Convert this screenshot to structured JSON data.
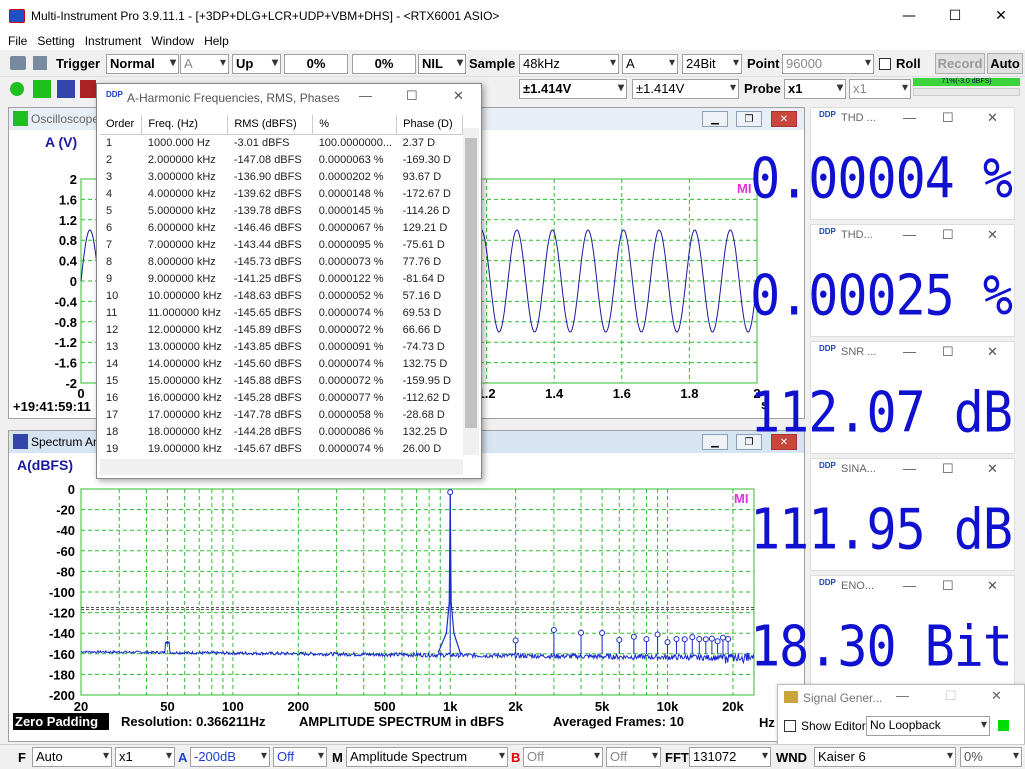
{
  "window": {
    "title": "Multi-Instrument Pro 3.9.11.1  -  [+3DP+DLG+LCR+UDP+VBM+DHS]  -  <RTX6001 ASIO>"
  },
  "menu": [
    "File",
    "Setting",
    "Instrument",
    "Window",
    "Help"
  ],
  "toolbar1": {
    "trigger_label": "Trigger",
    "trigger_mode": "Normal",
    "trigger_channel": "A",
    "trigger_edge": "Up",
    "trigger_level": "0%",
    "trigger_delay": "0%",
    "nil": "NIL",
    "sample_label": "Sample",
    "sample_rate": "48kHz",
    "channel": "A",
    "bits": "24Bit",
    "point_label": "Point",
    "point": "96000",
    "roll": "Roll",
    "record": "Record",
    "auto": "Auto"
  },
  "toolbar2": {
    "range_a": "±1.414V",
    "range_b": "±1.414V",
    "probe_label": "Probe",
    "probe_a": "x1",
    "probe_b": "x1",
    "level_meter": "71%(-3.0 dBFS)"
  },
  "oscilloscope": {
    "title": "Oscilloscope",
    "y_unit": "A (V)",
    "y_ticks": [
      "2",
      "1.6",
      "1.2",
      "0.8",
      "0.4",
      "0",
      "-0.4",
      "-0.8",
      "-1.2",
      "-1.6",
      "-2"
    ],
    "x_ticks": [
      "0",
      "1.2",
      "1.4",
      "1.6",
      "1.8",
      "2"
    ],
    "x_unit": "s",
    "timestamp": "+19:41:59:11",
    "mark": "MI",
    "cycles_visible": 19
  },
  "spectrum": {
    "title": "Spectrum Analyzer",
    "y_unit": "A(dBFS)",
    "y_ticks": [
      "0",
      "-20",
      "-40",
      "-60",
      "-80",
      "-100",
      "-120",
      "-140",
      "-160",
      "-180",
      "-200"
    ],
    "x_ticks": [
      "20",
      "50",
      "100",
      "200",
      "500",
      "1k",
      "2k",
      "5k",
      "10k",
      "20k"
    ],
    "x_unit": "Hz",
    "zero_padding": "Zero Padding",
    "resolution": "Resolution: 0.366211Hz",
    "mode_text": "AMPLITUDE SPECTRUM in dBFS",
    "averaged": "Averaged Frames: 10",
    "mark": "MI",
    "noise_floor_db": -158
  },
  "harmonics": {
    "title": "A-Harmonic Frequencies, RMS, Phases",
    "columns": [
      "Order",
      "Freq. (Hz)",
      "RMS (dBFS)",
      "%",
      "Phase (D)"
    ],
    "rows": [
      [
        "1",
        "1000.000 Hz",
        "-3.01 dBFS",
        "100.0000000...",
        "2.37  D"
      ],
      [
        "2",
        "2.000000 kHz",
        "-147.08 dBFS",
        "0.0000063  %",
        "-169.30  D"
      ],
      [
        "3",
        "3.000000 kHz",
        "-136.90 dBFS",
        "0.0000202  %",
        "93.67  D"
      ],
      [
        "4",
        "4.000000 kHz",
        "-139.62 dBFS",
        "0.0000148  %",
        "-172.67  D"
      ],
      [
        "5",
        "5.000000 kHz",
        "-139.78 dBFS",
        "0.0000145  %",
        "-114.26  D"
      ],
      [
        "6",
        "6.000000 kHz",
        "-146.46 dBFS",
        "0.0000067  %",
        "129.21  D"
      ],
      [
        "7",
        "7.000000 kHz",
        "-143.44 dBFS",
        "0.0000095  %",
        "-75.61  D"
      ],
      [
        "8",
        "8.000000 kHz",
        "-145.73 dBFS",
        "0.0000073  %",
        "77.76  D"
      ],
      [
        "9",
        "9.000000 kHz",
        "-141.25 dBFS",
        "0.0000122  %",
        "-81.64  D"
      ],
      [
        "10",
        "10.000000 kHz",
        "-148.63 dBFS",
        "0.0000052  %",
        "57.16  D"
      ],
      [
        "11",
        "11.000000 kHz",
        "-145.65 dBFS",
        "0.0000074  %",
        "69.53  D"
      ],
      [
        "12",
        "12.000000 kHz",
        "-145.89 dBFS",
        "0.0000072  %",
        "66.66  D"
      ],
      [
        "13",
        "13.000000 kHz",
        "-143.85 dBFS",
        "0.0000091  %",
        "-74.73  D"
      ],
      [
        "14",
        "14.000000 kHz",
        "-145.60 dBFS",
        "0.0000074  %",
        "132.75  D"
      ],
      [
        "15",
        "15.000000 kHz",
        "-145.88 dBFS",
        "0.0000072  %",
        "-159.95  D"
      ],
      [
        "16",
        "16.000000 kHz",
        "-145.28 dBFS",
        "0.0000077  %",
        "-112.62  D"
      ],
      [
        "17",
        "17.000000 kHz",
        "-147.78 dBFS",
        "0.0000058  %",
        "-28.68  D"
      ],
      [
        "18",
        "18.000000 kHz",
        "-144.28 dBFS",
        "0.0000086  %",
        "132.25  D"
      ],
      [
        "19",
        "19.000000 kHz",
        "-145.67 dBFS",
        "0.0000074  %",
        "26.00  D"
      ]
    ]
  },
  "meters": [
    {
      "name": "THD ...",
      "value": "0.00004 %"
    },
    {
      "name": "THD...",
      "value": "0.00025 %"
    },
    {
      "name": "SNR ...",
      "value": "112.07 dB"
    },
    {
      "name": "SINA...",
      "value": "111.95 dB"
    },
    {
      "name": "ENO...",
      "value": "18.30 Bit"
    }
  ],
  "signal_generator": {
    "title": "Signal Gener...",
    "show_editor": "Show Editor",
    "loopback": "No Loopback"
  },
  "bottom": {
    "f_label": "F",
    "f_mode": "Auto",
    "mult": "x1",
    "a_label": "A",
    "a_floor": "-200dB",
    "off1": "Off",
    "m_label": "M",
    "m_mode": "Amplitude Spectrum",
    "b_label": "B",
    "off2": "Off",
    "off3": "Off",
    "fft_label": "FFT",
    "fft_size": "131072",
    "wnd_label": "WND",
    "window": "Kaiser 6",
    "pct": "0%"
  },
  "chart_data": [
    {
      "type": "line",
      "title": "Oscilloscope",
      "ylabel": "A (V)",
      "xlabel": "s",
      "ylim": [
        -2,
        2
      ],
      "series": [
        {
          "name": "A",
          "amplitude": 1.0,
          "frequency_hz": 1000
        }
      ]
    },
    {
      "type": "line",
      "title": "Spectrum Analyzer",
      "ylabel": "A(dBFS)",
      "xlabel": "Hz",
      "xscale": "log",
      "xlim": [
        20,
        25000
      ],
      "ylim": [
        -200,
        0
      ],
      "harmonic_peaks": [
        {
          "x": 1000,
          "y": -3.01
        },
        {
          "x": 2000,
          "y": -147.08
        },
        {
          "x": 3000,
          "y": -136.9
        },
        {
          "x": 4000,
          "y": -139.62
        },
        {
          "x": 5000,
          "y": -139.78
        },
        {
          "x": 6000,
          "y": -146.46
        },
        {
          "x": 7000,
          "y": -143.44
        },
        {
          "x": 8000,
          "y": -145.73
        },
        {
          "x": 9000,
          "y": -141.25
        },
        {
          "x": 10000,
          "y": -148.63
        },
        {
          "x": 11000,
          "y": -145.65
        },
        {
          "x": 12000,
          "y": -145.89
        },
        {
          "x": 13000,
          "y": -143.85
        },
        {
          "x": 14000,
          "y": -145.6
        },
        {
          "x": 15000,
          "y": -145.88
        },
        {
          "x": 16000,
          "y": -145.28
        },
        {
          "x": 17000,
          "y": -147.78
        },
        {
          "x": 18000,
          "y": -144.28
        },
        {
          "x": 19000,
          "y": -145.67
        }
      ],
      "other_peaks": [
        {
          "x": 50,
          "y": -149
        }
      ],
      "threshold_lines": [
        -115,
        -117
      ]
    }
  ]
}
